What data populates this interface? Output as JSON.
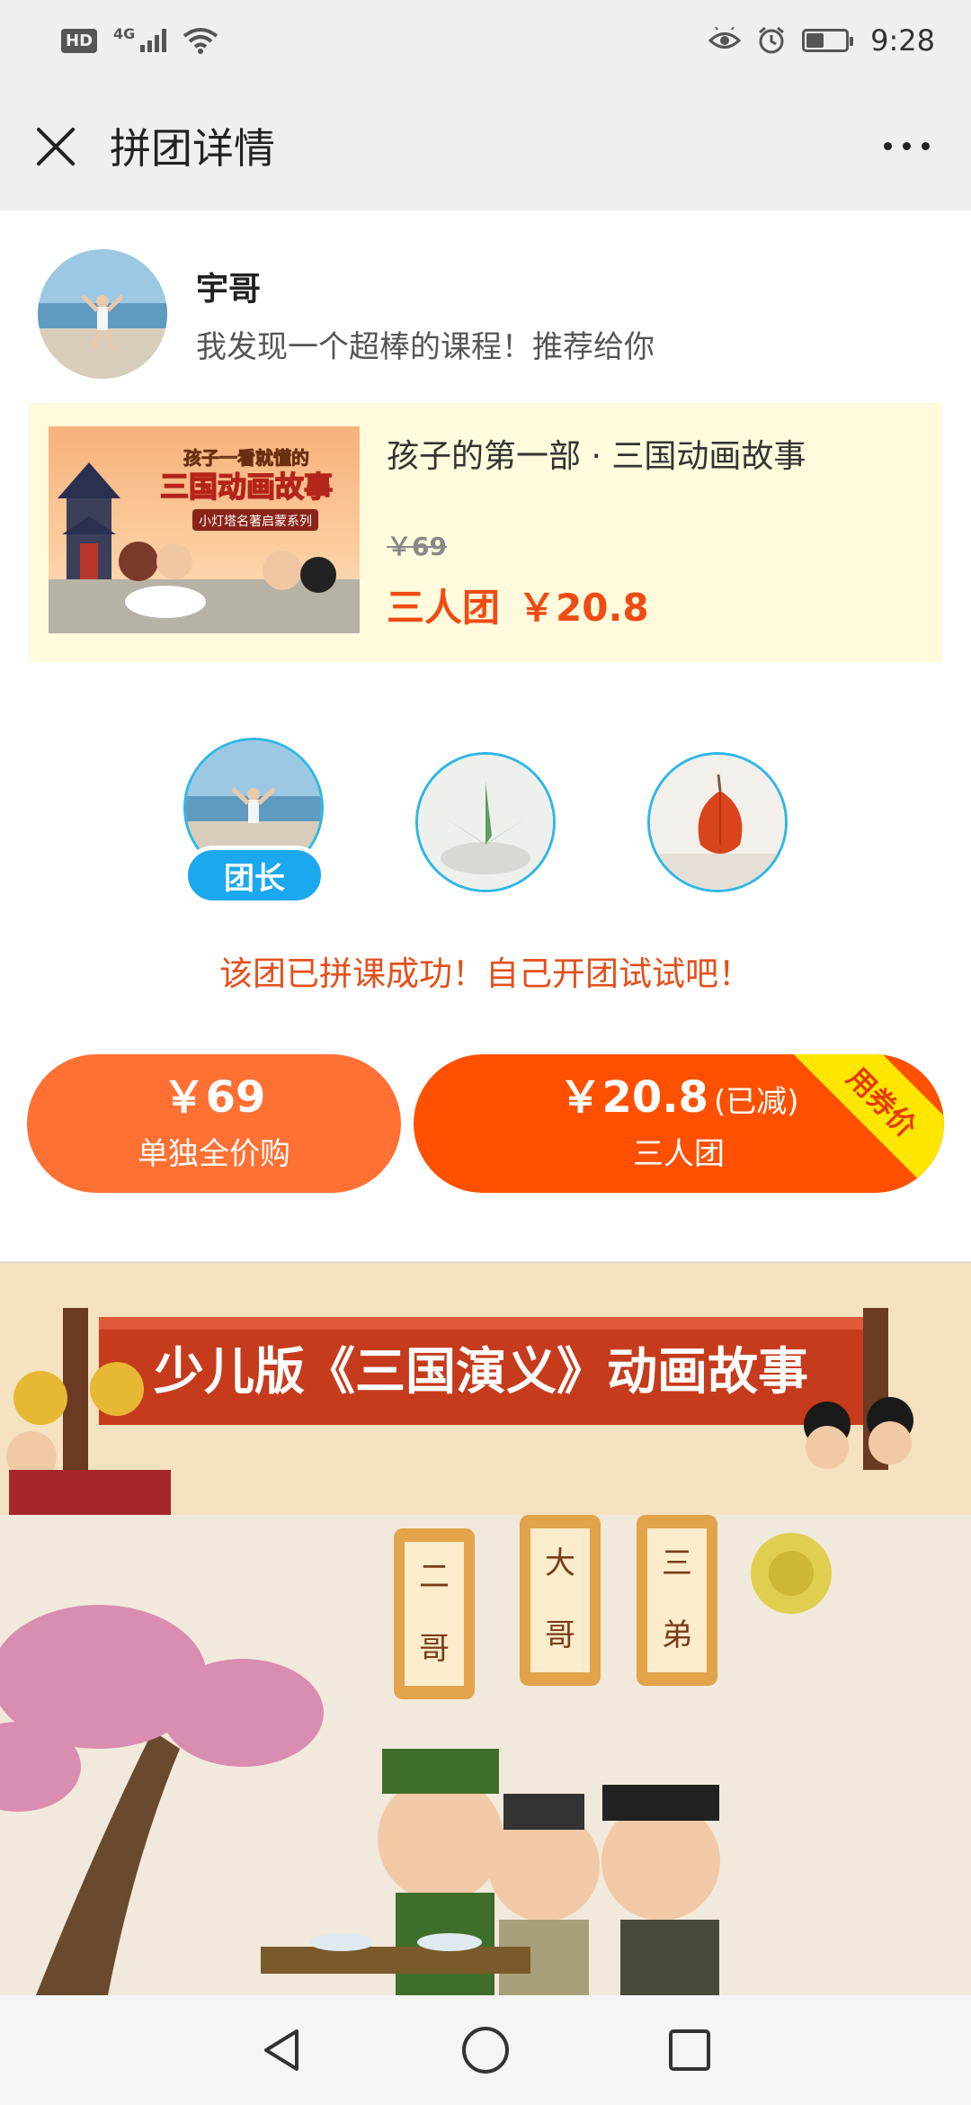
{
  "status_bar": {
    "hd_badge": "HD",
    "network_label": "4G",
    "time": "9:28",
    "battery_level": 0.45
  },
  "header": {
    "title": "拼团详情",
    "close_icon": "close-icon",
    "more_icon": "more-icon"
  },
  "sharer": {
    "name": "宇哥",
    "message": "我发现一个超棒的课程！推荐给你"
  },
  "course": {
    "title": "孩子的第一部 · 三国动画故事",
    "original_price": "￥69",
    "group_type": "三人团",
    "group_price": "￥20.8",
    "cover": {
      "headline_1": "孩子一看就懂的",
      "headline_2": "三国动画故事",
      "series": "小灯塔名著启蒙系列"
    }
  },
  "members": {
    "leader_badge": "团长"
  },
  "status_message": "该团已拼课成功！自己开团试试吧！",
  "buttons": {
    "solo": {
      "price": "￥69",
      "label": "单独全价购"
    },
    "group": {
      "price": "￥20.8",
      "note": "(已减)",
      "label": "三人团",
      "ribbon": "用券价"
    }
  },
  "poster": {
    "banner": "少儿版《三国演义》动画故事",
    "plaques": [
      "二哥",
      "大哥",
      "三弟"
    ]
  },
  "colors": {
    "accent_orange": "#ff5000",
    "solo_orange": "#ff7033",
    "price_red": "#f04b13",
    "leader_blue": "#1ba8ee",
    "card_yellow": "#fffbdc"
  }
}
